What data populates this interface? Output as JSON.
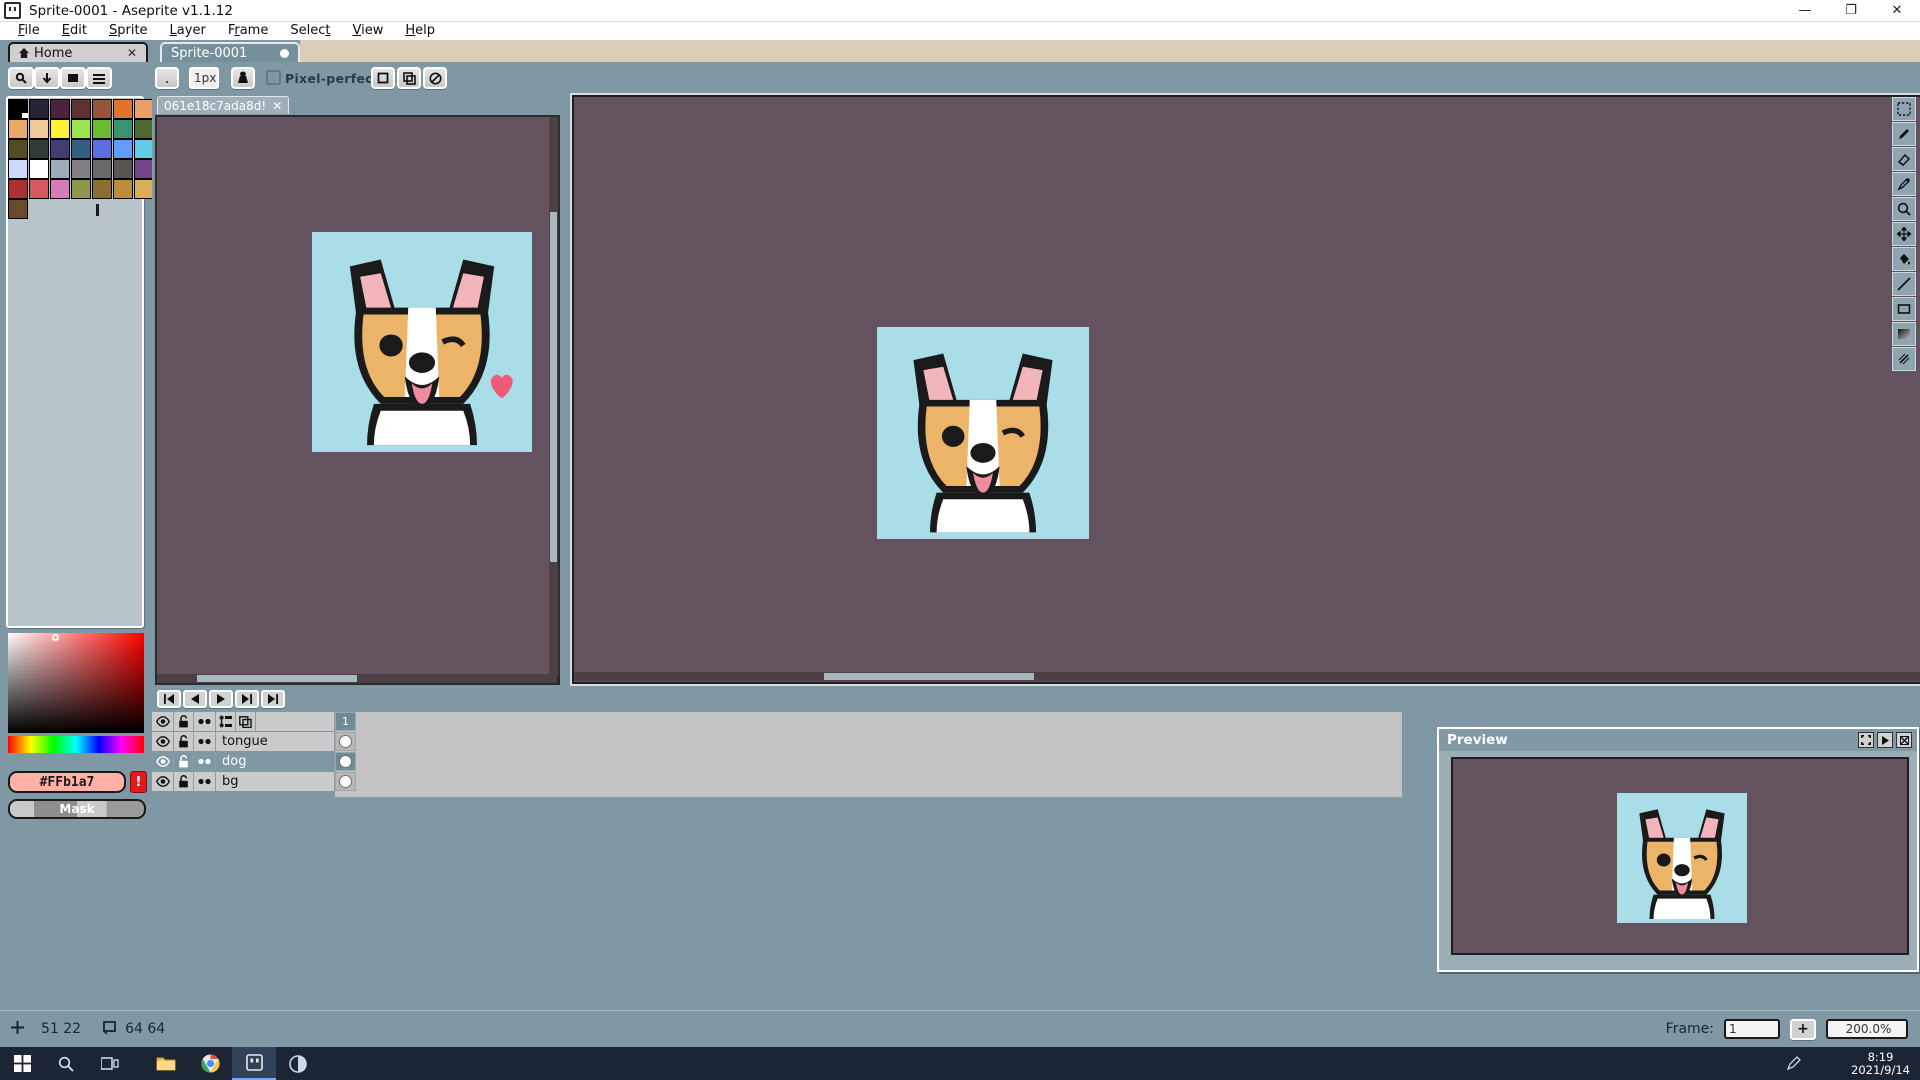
{
  "window": {
    "title": "Sprite-0001 - Aseprite v1.1.12",
    "icon": "aseprite-icon",
    "minimize_label": "—",
    "maximize_label": "❐",
    "close_label": "✕"
  },
  "menubar": {
    "items": [
      {
        "label": "File",
        "mnemonic": "F"
      },
      {
        "label": "Edit",
        "mnemonic": "E"
      },
      {
        "label": "Sprite",
        "mnemonic": "S"
      },
      {
        "label": "Layer",
        "mnemonic": "L"
      },
      {
        "label": "Frame",
        "mnemonic": "r"
      },
      {
        "label": "Select",
        "mnemonic": "t"
      },
      {
        "label": "View",
        "mnemonic": "V"
      },
      {
        "label": "Help",
        "mnemonic": "H"
      }
    ]
  },
  "tabs": {
    "home": {
      "label": "Home",
      "close": "✕",
      "icon": "home-icon"
    },
    "sprite": {
      "label": "Sprite-0001",
      "modified_dot": "●",
      "active": true
    }
  },
  "context_toolbar": {
    "tool_buttons": [
      {
        "name": "brush-tool",
        "glyph": "✎"
      },
      {
        "name": "ink-tool",
        "glyph": "↓"
      },
      {
        "name": "shade-tool",
        "glyph": "■"
      },
      {
        "name": "options-tool",
        "glyph": "☰"
      }
    ],
    "brush_shape": ".",
    "brush_size": "1px",
    "symmetry_glyph": "♙",
    "pixel_perfect_label": "Pixel-perfect",
    "pixel_perfect_checked": false,
    "right_buttons": [
      {
        "name": "selection-mode-replace",
        "glyph": "□"
      },
      {
        "name": "selection-mode-add",
        "glyph": "⧉"
      },
      {
        "name": "selection-mode-subtract",
        "glyph": "⊘"
      }
    ]
  },
  "palette": {
    "colors": [
      "#000000",
      "#262335",
      "#4a2340",
      "#5e3030",
      "#96563b",
      "#e0742a",
      "#e8a06a",
      "#e8a86a",
      "#f0c79b",
      "#fbf236",
      "#99e550",
      "#6abe30",
      "#37946e",
      "#4b692f",
      "#524b24",
      "#323c39",
      "#3f3f74",
      "#306082",
      "#5b6ee1",
      "#639bff",
      "#5fcde4",
      "#cbdbfc",
      "#ffffff",
      "#9badb7",
      "#847e87",
      "#696a6a",
      "#595652",
      "#76428a",
      "#ac3232",
      "#d95763",
      "#d77bba",
      "#8f974a",
      "#8a6f30",
      "#bb8c3e",
      "#d8b05a",
      "#6a4a2c"
    ],
    "selected_index": 0
  },
  "color_picker": {
    "hex_value": "#FFb1a7",
    "warning_glyph": "!",
    "mask_label": "Mask"
  },
  "subwindow": {
    "tab_label": "061e18c7ada8d!",
    "close": "✕"
  },
  "right_toolbar": {
    "tools": [
      {
        "name": "marquee-tool",
        "glyph": "marquee"
      },
      {
        "name": "pencil-tool",
        "glyph": "pencil"
      },
      {
        "name": "eraser-tool",
        "glyph": "eraser"
      },
      {
        "name": "eyedropper-tool",
        "glyph": "eyedropper"
      },
      {
        "name": "zoom-tool",
        "glyph": "zoom"
      },
      {
        "name": "move-tool",
        "glyph": "move"
      },
      {
        "name": "paint-bucket-tool",
        "glyph": "bucket"
      },
      {
        "name": "line-tool",
        "glyph": "line"
      },
      {
        "name": "rectangle-tool",
        "glyph": "rectangle"
      },
      {
        "name": "gradient-tool",
        "glyph": "gradient"
      },
      {
        "name": "blur-tool",
        "glyph": "blur"
      }
    ]
  },
  "frame_nav": {
    "buttons": [
      {
        "name": "goto-first-frame",
        "glyph": "⏮"
      },
      {
        "name": "goto-previous-frame",
        "glyph": "◀"
      },
      {
        "name": "play-animation",
        "glyph": "▶"
      },
      {
        "name": "goto-next-frame",
        "glyph": "▶❙"
      },
      {
        "name": "goto-last-frame",
        "glyph": "⏭"
      }
    ]
  },
  "timeline": {
    "header": {
      "eye_icon": "eye-icon",
      "lock_icon": "lock-icon",
      "continuous_icon": "continuous-icon",
      "onionskin_icon": "onionskin-icon",
      "layer_group_icon": "layer-group-icon",
      "frame_number": "1"
    },
    "layers": [
      {
        "name": "tongue",
        "visible": true,
        "locked": true,
        "continuous": true,
        "selected": false,
        "has_cel": true
      },
      {
        "name": "dog",
        "visible": true,
        "locked": true,
        "continuous": true,
        "selected": true,
        "has_cel": true
      },
      {
        "name": "bg",
        "visible": true,
        "locked": true,
        "continuous": true,
        "selected": false,
        "has_cel": true
      }
    ]
  },
  "preview": {
    "title": "Preview",
    "buttons": [
      {
        "name": "preview-fit-button",
        "glyph": "⬚"
      },
      {
        "name": "preview-play-button",
        "glyph": "▶"
      },
      {
        "name": "preview-close-button",
        "glyph": "✕"
      }
    ]
  },
  "statusbar": {
    "cursor_icon": "crosshair-icon",
    "cursor_position": "51 22",
    "size_icon": "canvas-size-icon",
    "canvas_size": "64 64",
    "frame_label": "Frame:",
    "frame_value": "1",
    "add_frame_label": "+",
    "zoom_value": "200.0%"
  },
  "taskbar": {
    "start_icon": "windows-start-icon",
    "search_icon": "search-icon",
    "taskview_icon": "task-view-icon",
    "explorer_icon": "file-explorer-icon",
    "chrome_icon": "chrome-icon",
    "aseprite_icon": "aseprite-taskbar-icon",
    "other_icon": "other-app-icon",
    "tray_icon": "pen-tray-icon",
    "time": "8:19",
    "date": "2021/9/14"
  },
  "colors": {
    "app_bg": "#7f98a3",
    "canvas_bg": "#65525f",
    "sprite_bg": "#a9dde8",
    "accent": "#ffb1a7"
  }
}
